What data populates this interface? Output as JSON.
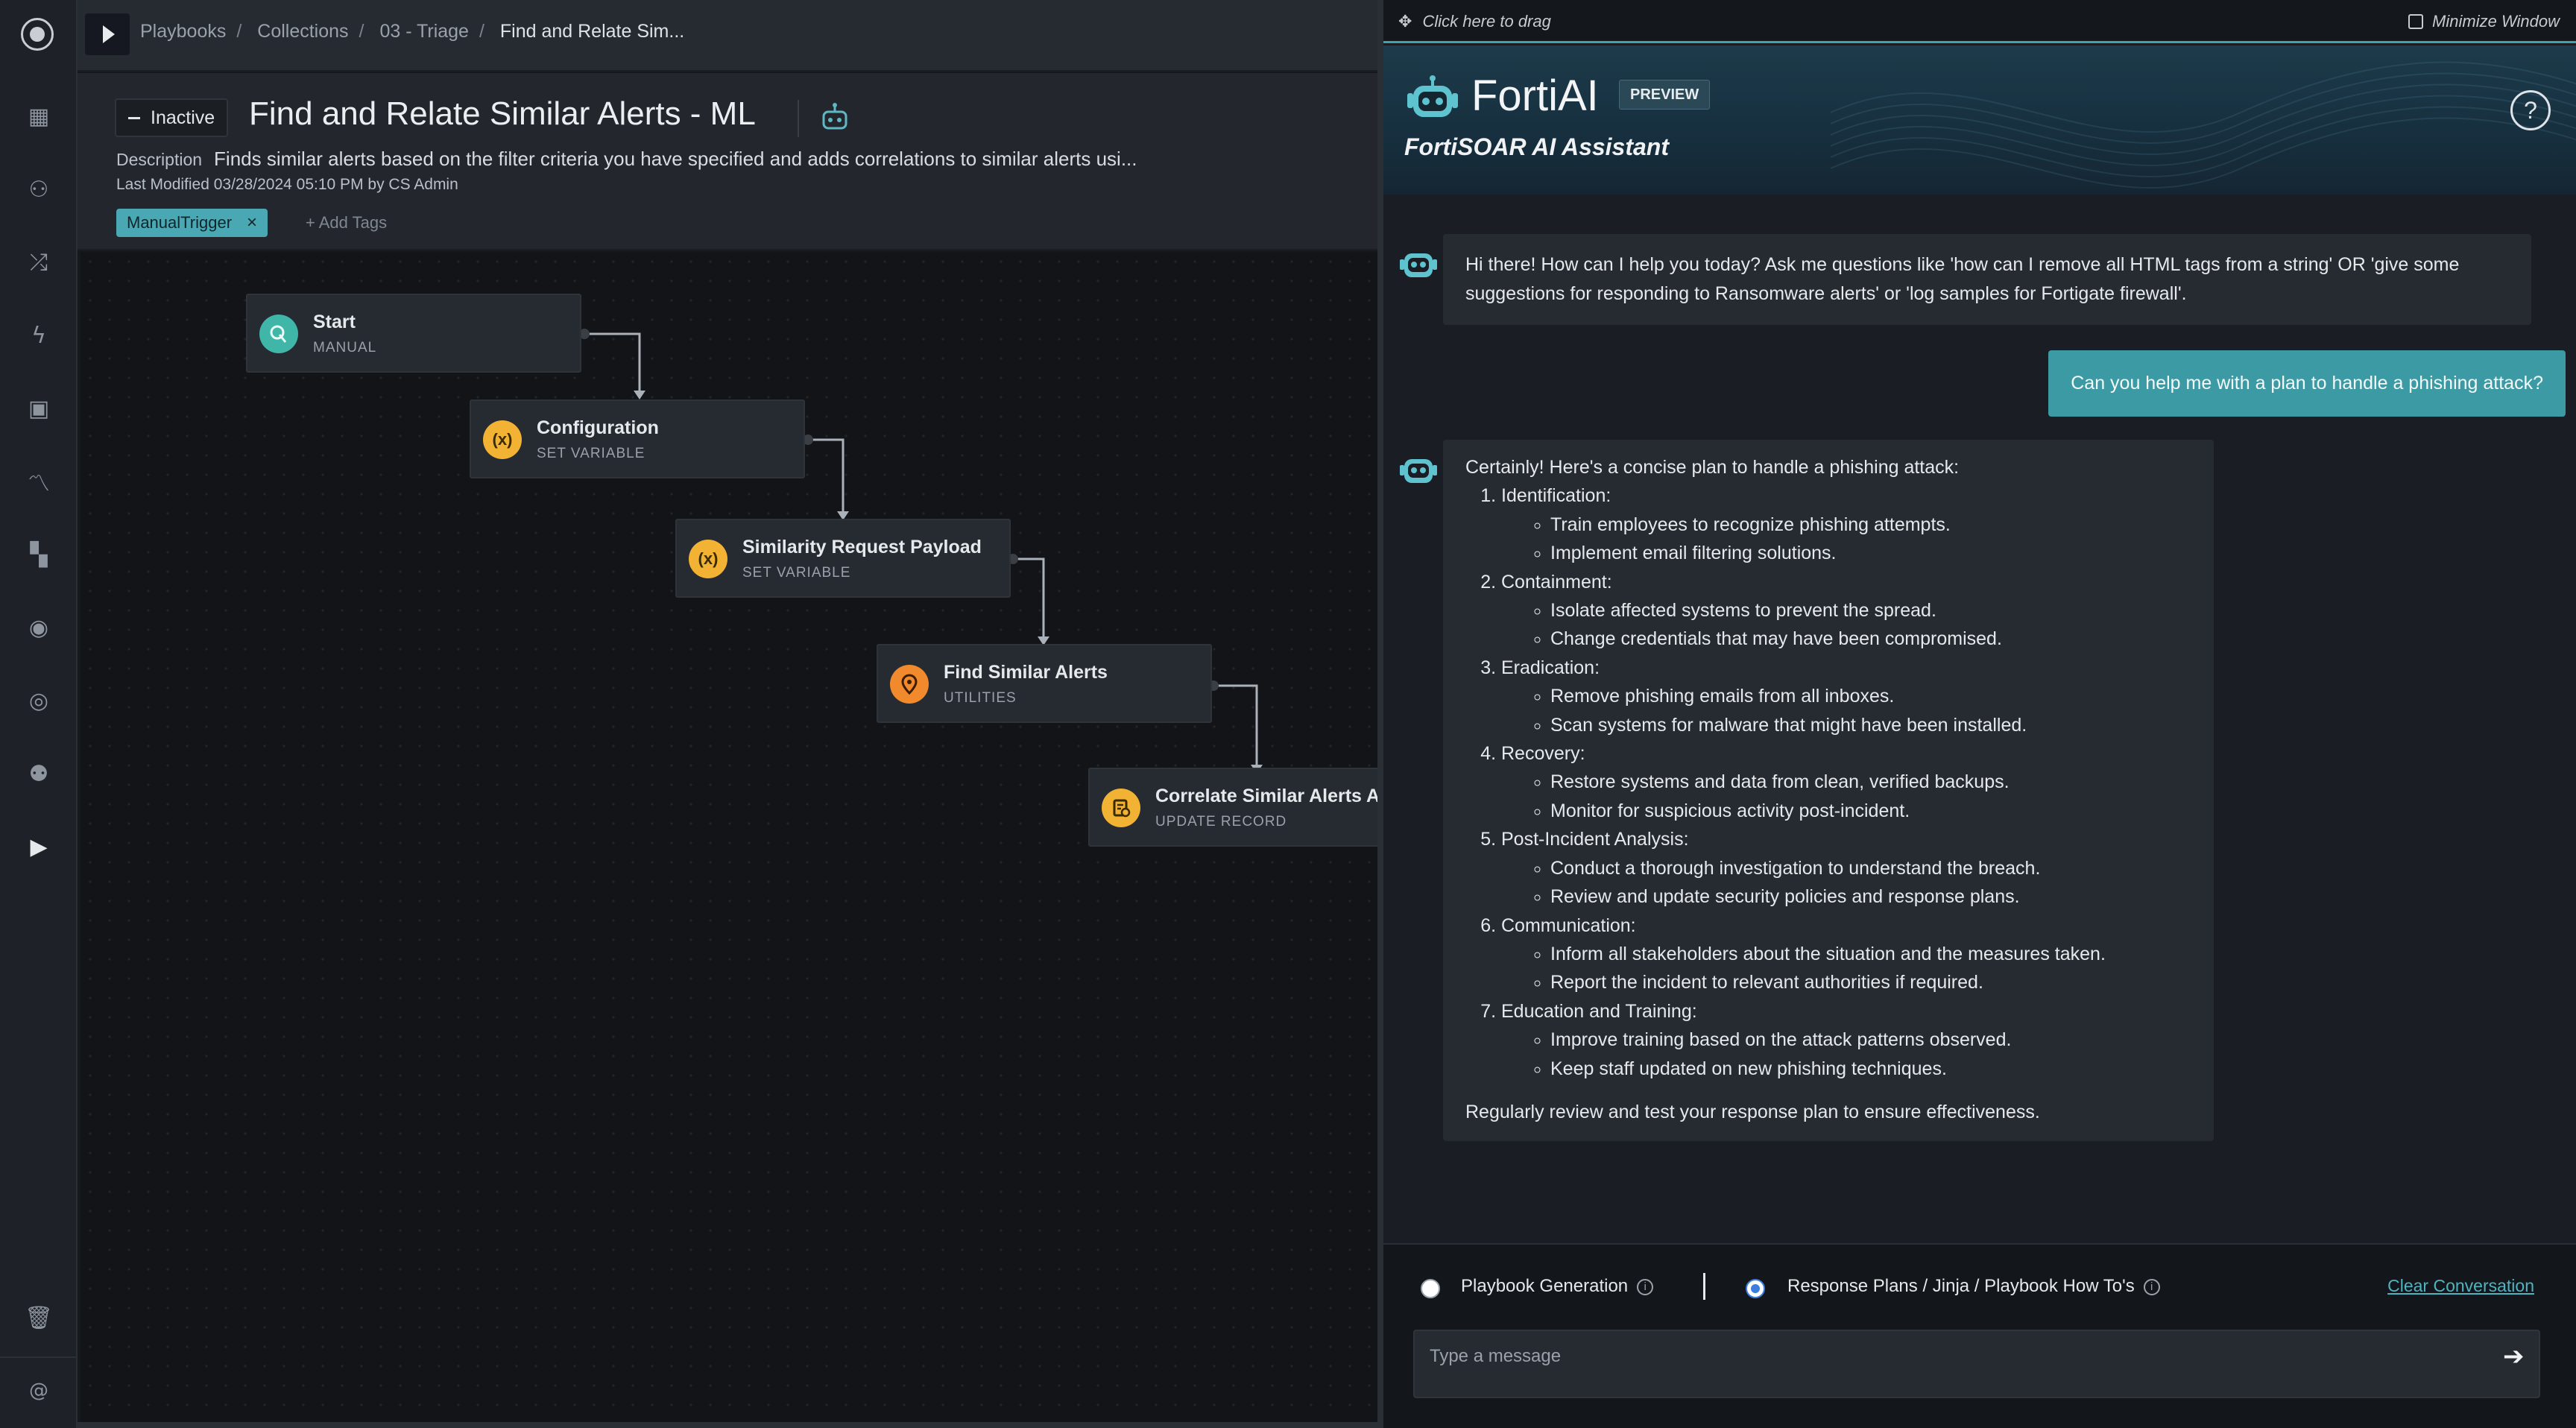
{
  "breadcrumb": {
    "items": [
      "Playbooks",
      "Collections",
      "03 - Triage"
    ],
    "current": "Find and Relate Sim..."
  },
  "playbook": {
    "status": "Inactive",
    "title": "Find and Relate Similar Alerts - ML",
    "description_label": "Description",
    "description": "Finds similar alerts based on the filter criteria you have specified and adds correlations to similar alerts usi...",
    "last_modified": "Last Modified 03/28/2024 05:10 PM by CS Admin",
    "tag": "ManualTrigger",
    "add_tags": "+ Add Tags"
  },
  "nodes": [
    {
      "title": "Start",
      "subtitle": "MANUAL",
      "icon": "trigger-icon",
      "color": "#3fb6a8"
    },
    {
      "title": "Configuration",
      "subtitle": "SET VARIABLE",
      "icon": "variable-icon",
      "color": "#f2b233"
    },
    {
      "title": "Similarity Request Payload",
      "subtitle": "SET VARIABLE",
      "icon": "variable-icon",
      "color": "#f2b233"
    },
    {
      "title": "Find Similar Alerts",
      "subtitle": "UTILITIES",
      "icon": "utilities-icon",
      "color": "#f08a2c"
    },
    {
      "title": "Correlate Similar Alerts A...",
      "subtitle": "UPDATE RECORD",
      "icon": "update-record-icon",
      "color": "#f2b233"
    }
  ],
  "variable_icon_glyph": "(x)",
  "assistant": {
    "drag_hint": "Click here to drag",
    "minimize": "Minimize Window",
    "brand": "FortiAI",
    "badge": "PREVIEW",
    "subtitle": "FortiSOAR AI Assistant",
    "help_glyph": "?",
    "accent": "#3b9aa4"
  },
  "chat": {
    "greeting": "Hi there! How can I help you today? Ask me questions like 'how can I remove all HTML tags from a string' OR 'give some suggestions for responding to Ransomware alerts' or 'log samples for Fortigate firewall'.",
    "user_message": "Can you help me with a plan to handle a phishing attack?",
    "answer_intro": "Certainly! Here's a concise plan to handle a phishing attack:",
    "steps": [
      {
        "title": "Identification:",
        "items": [
          "Train employees to recognize phishing attempts.",
          "Implement email filtering solutions."
        ]
      },
      {
        "title": "Containment:",
        "items": [
          "Isolate affected systems to prevent the spread.",
          "Change credentials that may have been compromised."
        ]
      },
      {
        "title": "Eradication:",
        "items": [
          "Remove phishing emails from all inboxes.",
          "Scan systems for malware that might have been installed."
        ]
      },
      {
        "title": "Recovery:",
        "items": [
          "Restore systems and data from clean, verified backups.",
          "Monitor for suspicious activity post-incident."
        ]
      },
      {
        "title": "Post-Incident Analysis:",
        "items": [
          "Conduct a thorough investigation to understand the breach.",
          "Review and update security policies and response plans."
        ]
      },
      {
        "title": "Communication:",
        "items": [
          "Inform all stakeholders about the situation and the measures taken.",
          "Report the incident to relevant authorities if required."
        ]
      },
      {
        "title": "Education and Training:",
        "items": [
          "Improve training based on the attack patterns observed.",
          "Keep staff updated on new phishing techniques."
        ]
      }
    ],
    "answer_outro": "Regularly review and test your response plan to ensure effectiveness."
  },
  "composer": {
    "option_1": "Playbook Generation",
    "option_2": "Response Plans / Jinja / Playbook How To's",
    "selected": "option_2",
    "clear": "Clear Conversation",
    "placeholder": "Type a message",
    "send_glyph": "➔"
  },
  "rail_icons": [
    "dashboard-icon",
    "queue-icon",
    "shuffle-icon",
    "bolt-icon",
    "briefcase-icon",
    "chart-icon",
    "apps-icon",
    "shield-icon",
    "globe-icon",
    "users-icon",
    "play-icon",
    "trash-icon",
    "at-icon"
  ]
}
